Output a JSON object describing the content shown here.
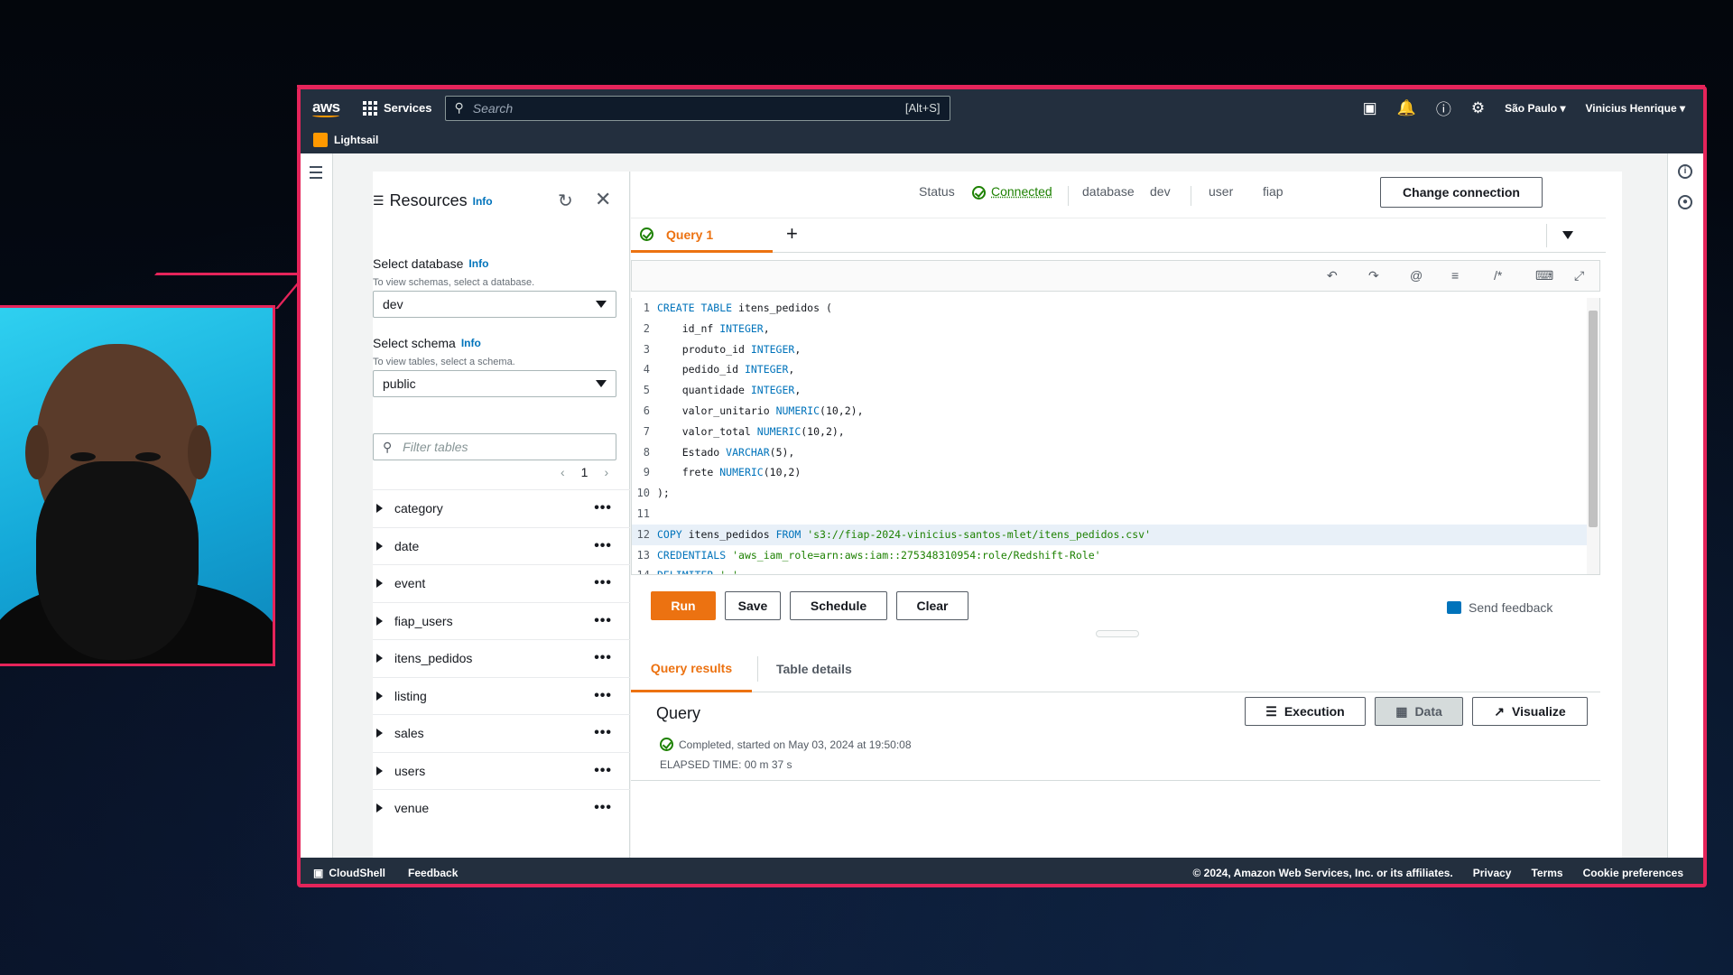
{
  "topnav": {
    "logo": "aws",
    "services_label": "Services",
    "search_placeholder": "Search",
    "search_shortcut": "[Alt+S]",
    "region": "São Paulo ▾",
    "user": "Vinicius Henrique ▾"
  },
  "subnav": {
    "service": "Lightsail"
  },
  "resources": {
    "title": "Resources",
    "info": "Info",
    "select_database_label": "Select database",
    "select_database_hint": "To view schemas, select a database.",
    "database_value": "dev",
    "select_schema_label": "Select schema",
    "select_schema_hint": "To view tables, select a schema.",
    "schema_value": "public",
    "filter_placeholder": "Filter tables",
    "page": "1",
    "tables": [
      "category",
      "date",
      "event",
      "fiap_users",
      "itens_pedidos",
      "listing",
      "sales",
      "users",
      "venue"
    ]
  },
  "connection": {
    "status_label": "Status",
    "status_value": "Connected",
    "database_label": "database",
    "database_value": "dev",
    "user_label": "user",
    "user_value": "fiap",
    "change_button": "Change connection"
  },
  "editor": {
    "tab_label": "Query 1",
    "lines": [
      {
        "n": "1",
        "t": "CREATE TABLE itens_pedidos ("
      },
      {
        "n": "2",
        "t": "    id_nf INTEGER,"
      },
      {
        "n": "3",
        "t": "    produto_id INTEGER,"
      },
      {
        "n": "4",
        "t": "    pedido_id INTEGER,"
      },
      {
        "n": "5",
        "t": "    quantidade INTEGER,"
      },
      {
        "n": "6",
        "t": "    valor_unitario NUMERIC(10,2),"
      },
      {
        "n": "7",
        "t": "    valor_total NUMERIC(10,2),"
      },
      {
        "n": "8",
        "t": "    Estado VARCHAR(5),"
      },
      {
        "n": "9",
        "t": "    frete NUMERIC(10,2)"
      },
      {
        "n": "10",
        "t": ");"
      },
      {
        "n": "11",
        "t": ""
      },
      {
        "n": "12",
        "t": "COPY itens_pedidos FROM 's3://fiap-2024-vinicius-santos-mlet/itens_pedidos.csv'"
      },
      {
        "n": "13",
        "t": "CREDENTIALS 'aws_iam_role=arn:aws:iam::275348310954:role/Redshift-Role'"
      },
      {
        "n": "14",
        "t": "DELIMITER ','"
      }
    ],
    "buttons": {
      "run": "Run",
      "save": "Save",
      "schedule": "Schedule",
      "clear": "Clear"
    },
    "feedback": "Send feedback"
  },
  "results": {
    "tab_results": "Query results",
    "tab_details": "Table details",
    "heading": "Query",
    "execution": "Execution",
    "data": "Data",
    "visualize": "Visualize",
    "status": "Completed, started on May 03, 2024 at 19:50:08",
    "elapsed": "ELAPSED TIME: 00 m 37 s"
  },
  "footer": {
    "cloudshell": "CloudShell",
    "feedback": "Feedback",
    "copyright": "© 2024, Amazon Web Services, Inc. or its affiliates.",
    "privacy": "Privacy",
    "terms": "Terms",
    "cookies": "Cookie preferences"
  },
  "colors": {
    "accent": "#ec7211",
    "nav": "#232f3e",
    "frame": "#e5245a",
    "success": "#1d8102"
  }
}
